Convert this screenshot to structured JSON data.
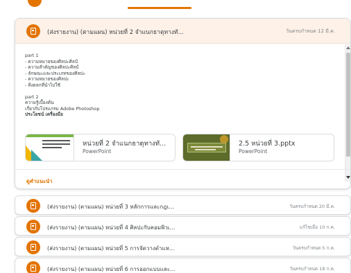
{
  "expanded": {
    "title": "(ส่งรายงาน) (ตามแผน) หน่วยที่ 2 จำแนกธาตุทางทั...",
    "date": "วันครบกำหนด 12 มี.ค.",
    "description": [
      {
        "text": "part 1",
        "bold": false
      },
      {
        "text": "- ความหมายของศิลปะศิลป์",
        "bold": false
      },
      {
        "text": "- ความสำคัญของศิลปะศิลป์",
        "bold": false
      },
      {
        "text": "- ลักษณะและประเภทของศิลปะ",
        "bold": false
      },
      {
        "text": "- ความหมายของศิลปะ",
        "bold": false
      },
      {
        "text": "- สิ่งตลกที่นำไปใช้",
        "bold": false
      },
      {
        "text": "",
        "bold": false
      },
      {
        "text": "part 2",
        "bold": false
      },
      {
        "text": "ความรู้เบื้องต้น",
        "bold": false
      },
      {
        "text": "เกี่ยวกับโปรแกรม Adobe Photoshop",
        "bold": false
      },
      {
        "text": "ประโยชน์ เครื่องมือ",
        "bold": true
      }
    ],
    "attachments": [
      {
        "title": "หน่วยที่ 2 จำแนกธาตุทางทั...",
        "type": "PowerPoint"
      },
      {
        "title": "2.5 หน่วยที่ 3.pptx",
        "type": "PowerPoint"
      }
    ],
    "view_link": "ดูคำแนะนำ"
  },
  "rows": [
    {
      "title": "(ส่งรายงาน) (ตามแผน) หน่วยที่ 3 หลักการและกฎเ...",
      "date": "วันครบกำหนด 20 มี.ค."
    },
    {
      "title": "(ส่งรายงาน) (ตามแผน) หน่วยที่ 4 ศิลปะกับคอมพิวเ...",
      "date": "แก้ไขเมื่อ 10 ก.ค."
    },
    {
      "title": "(ส่งรายงาน) (ตามแผน) หน่วยที่ 5 การจัดวางตำแห...",
      "date": "วันครบกำหนด 5 ก.ค."
    },
    {
      "title": "(ส่งรายงาน) (ตามแผน) หน่วยที่ 6 การออกแบบและ...",
      "date": "วันครบกำหนด 18 ก.ค."
    }
  ],
  "colors": {
    "accent": "#e37400",
    "header_tint": "#fdf1e8"
  },
  "icons": {
    "assignment": "assignment-icon"
  }
}
